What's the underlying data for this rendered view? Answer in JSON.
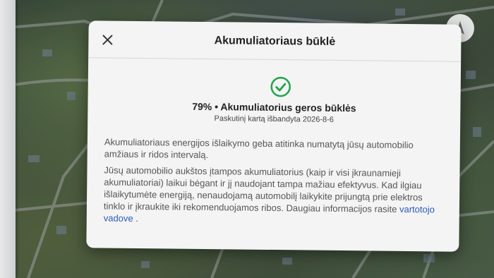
{
  "modal": {
    "title": "Akumuliatoriaus būklė",
    "status": "79% • Akumuliatorius geros būklės",
    "last_tested": "Paskutinį kartą išbandyta 2026-8-6",
    "paragraph1": "Akumuliatoriaus energijos išlaikymo geba atitinka numatytą jūsų automobilio amžiaus ir ridos intervalą.",
    "paragraph2": "Jūsų automobilio aukštos įtampos akumuliatorius (kaip ir visi įkraunamieji akumuliatoriai) laikui bėgant ir jį naudojant tampa mažiau efektyvus. Kad ilgiau išlaikytumėte energiją, nenaudojamą automobilį laikykite prijungtą prie elektros tinklo ir įkraukite iki rekomenduojamos ribos. Daugiau informacijos rasite",
    "link_text": "vartotojo vadove",
    "trailing": " ."
  },
  "icons": {
    "close": "close-icon",
    "status": "check-circle-icon",
    "map_control": "compass-icon"
  },
  "colors": {
    "check_green": "#22a34a",
    "link_blue": "#2a5bb8"
  }
}
